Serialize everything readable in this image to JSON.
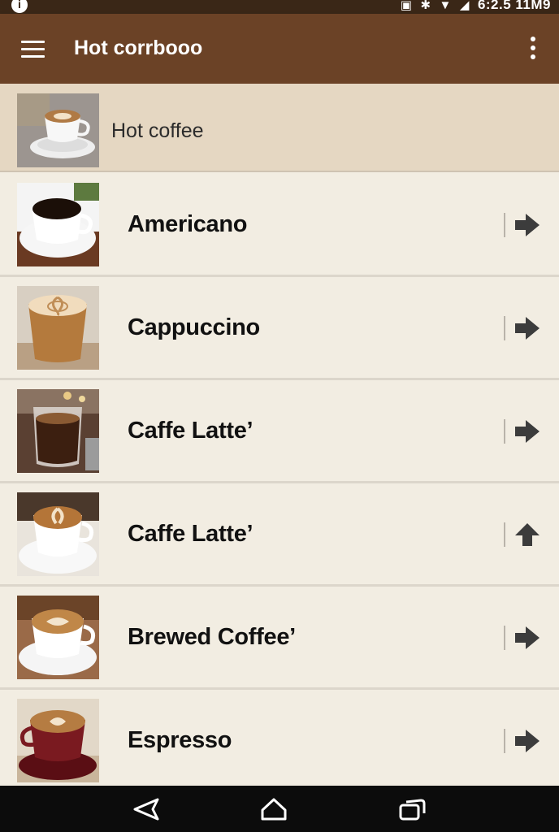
{
  "status_bar": {
    "time": "6:2.5 11M9"
  },
  "app_bar": {
    "title": "Hot corrbooo"
  },
  "category": {
    "label": "Hot coffee"
  },
  "items": [
    {
      "name": "Americano",
      "action_icon": "arrow-right-icon"
    },
    {
      "name": "Cappuccino",
      "action_icon": "arrow-right-icon"
    },
    {
      "name": "Caffe Latte’",
      "action_icon": "arrow-right-icon"
    },
    {
      "name": "Caffe Latte’",
      "action_icon": "arrow-up-icon"
    },
    {
      "name": "Brewed Coffee’",
      "action_icon": "arrow-right-icon"
    },
    {
      "name": "Espresso",
      "action_icon": "arrow-right-icon"
    }
  ],
  "colors": {
    "app_bar": "#6b4226",
    "status_bar": "#3a2717",
    "category_bg": "#e5d7c2",
    "list_bg": "#f2ede2",
    "nav_bar": "#0c0c0c"
  }
}
